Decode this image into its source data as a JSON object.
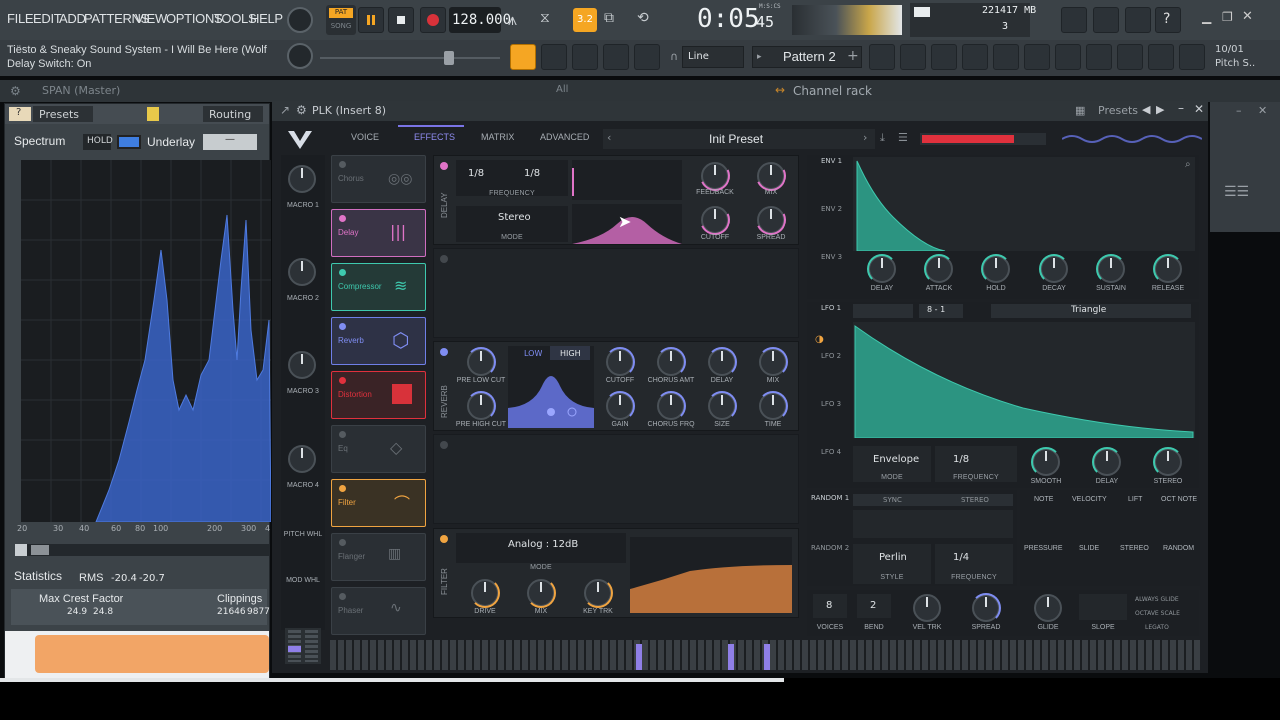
{
  "menu": [
    "FILE",
    "EDIT",
    "ADD",
    "PATTERNS",
    "VIEW",
    "OPTIONS",
    "TOOLS",
    "HELP"
  ],
  "transport": {
    "pat_label": "PAT",
    "song_label": "SONG",
    "tempo": "128.000",
    "time": "0:05",
    "time_small": "45",
    "time_unit": "M:S:CS",
    "pattern_small": "3.2"
  },
  "cpu": {
    "value": "22",
    "mem": "1417 MB",
    "voices": "3"
  },
  "hint_bar": {
    "line1": "Tiësto & Sneaky Sound System - I Will Be Here (Wolf",
    "line2": "Delay Switch: On"
  },
  "toolbar2": {
    "snap": "Line",
    "pattern": "Pattern 2",
    "date": "10/01",
    "pitch": "Pitch S.."
  },
  "strip3": {
    "span_title": "SPAN (Master)",
    "all": "All",
    "channel_rack": "Channel rack"
  },
  "span": {
    "presets": "Presets",
    "routing": "Routing",
    "spectrum": "Spectrum",
    "hold": "HOLD",
    "underlay": "Underlay",
    "underlay_val": "—",
    "freq_ticks": [
      "20",
      "30",
      "40",
      "60",
      "80",
      "100",
      "200",
      "300",
      "4"
    ],
    "statistics": "Statistics",
    "rms_label": "RMS",
    "rms_l": "-20.4",
    "rms_r": "-20.7",
    "crest_label": "Max Crest Factor",
    "crest_l": "24.9",
    "crest_r": "24.8",
    "clip_label": "Clippings",
    "clip_l": "21646",
    "clip_r": "9877"
  },
  "plk": {
    "title": "PLK (Insert 8)",
    "presets": "Presets",
    "tabs": [
      "VOICE",
      "EFFECTS",
      "MATRIX",
      "ADVANCED"
    ],
    "preset_name": "Init Preset",
    "macros": [
      "MACRO 1",
      "MACRO 2",
      "MACRO 3",
      "MACRO 4",
      "PITCH WHL",
      "MOD WHL"
    ],
    "modules": [
      "Chorus",
      "Delay",
      "Compressor",
      "Reverb",
      "Distortion",
      "Eq",
      "Filter",
      "Flanger",
      "Phaser"
    ],
    "delay": {
      "side": "DELAY",
      "left_sync": "1/8",
      "right_sync": "1/8",
      "frequency": "FREQUENCY",
      "mode_val": "Stereo",
      "mode": "MODE",
      "feedback": "FEEDBACK",
      "mix": "MIX",
      "cutoff": "CUTOFF",
      "spread": "SPREAD"
    },
    "reverb": {
      "side": "REVERB",
      "low": "LOW",
      "high": "HIGH",
      "pre_low": "PRE LOW CUT",
      "pre_high": "PRE HIGH CUT",
      "cutoff": "CUTOFF",
      "chorus_amt": "CHORUS AMT",
      "delay": "DELAY",
      "mix": "MIX",
      "gain": "GAIN",
      "chorus_frq": "CHORUS FRQ",
      "size": "SIZE",
      "time": "TIME"
    },
    "filter": {
      "side": "FILTER",
      "mode_val": "Analog : 12dB",
      "mode": "MODE",
      "drive": "DRIVE",
      "mix": "MIX",
      "key_trk": "KEY TRK"
    },
    "env": {
      "labels": [
        "ENV 1",
        "ENV 2",
        "ENV 3"
      ],
      "knobs": [
        "DELAY",
        "ATTACK",
        "HOLD",
        "DECAY",
        "SUSTAIN",
        "RELEASE"
      ]
    },
    "lfo": {
      "labels": [
        "LFO 1",
        "LFO 2",
        "LFO 3",
        "LFO 4"
      ],
      "ratio": "8 - 1",
      "shape": "Triangle",
      "mode_val": "Envelope",
      "freq_val": "1/8",
      "mode": "MODE",
      "frequency": "FREQUENCY",
      "smooth": "SMOOTH",
      "delay": "DELAY",
      "stereo": "STEREO"
    },
    "random": {
      "labels": [
        "RANDOM 1",
        "RANDOM 2"
      ],
      "sync": "SYNC",
      "stereo": "STEREO",
      "style_val": "Perlin",
      "freq_val": "1/4",
      "style": "STYLE",
      "frequency": "FREQUENCY"
    },
    "note_mods": [
      "NOTE",
      "VELOCITY",
      "LIFT",
      "OCT NOTE",
      "PRESSURE",
      "SLIDE",
      "STEREO",
      "RANDOM"
    ],
    "voice": {
      "voices_val": "8",
      "bend_val": "2",
      "voices": "VOICES",
      "bend": "BEND",
      "vel_trk": "VEL TRK",
      "spread": "SPREAD",
      "glide": "GLIDE",
      "slope": "SLOPE",
      "always_glide": "ALWAYS GLIDE",
      "octave_scale": "OCTAVE SCALE",
      "legato": "LEGATO"
    }
  },
  "colors": {
    "accent_pink": "#e074c8",
    "accent_teal": "#3ec9ae",
    "accent_blue": "#6f7fe8",
    "accent_orange": "#f0a441",
    "span_fill": "#3a64c8"
  }
}
